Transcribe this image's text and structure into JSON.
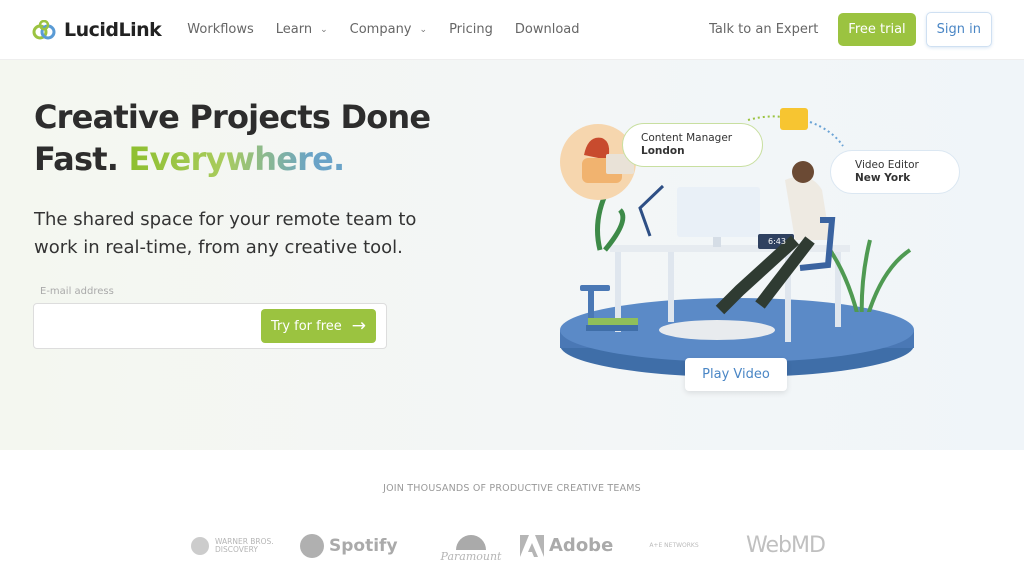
{
  "nav": {
    "brand": "LucidLink",
    "items": [
      {
        "label": "Workflows",
        "dropdown": false
      },
      {
        "label": "Learn",
        "dropdown": true
      },
      {
        "label": "Company",
        "dropdown": true
      },
      {
        "label": "Pricing",
        "dropdown": false
      },
      {
        "label": "Download",
        "dropdown": false
      }
    ],
    "talk": "Talk to an Expert",
    "free_trial": "Free trial",
    "sign_in": "Sign in"
  },
  "hero": {
    "title_line1": "Creative Projects Done",
    "title_fast": "Fast.",
    "title_accent": "Everywhere.",
    "subtitle": "The shared space for your remote team to work in real-time, from any creative tool.",
    "email_label": "E-mail address",
    "email_value": "",
    "cta": "Try for free"
  },
  "illustration": {
    "bubble1_role": "Content Manager",
    "bubble1_city": "London",
    "bubble2_role": "Video Editor",
    "bubble2_city": "New York",
    "clock": "6:43",
    "play": "Play Video"
  },
  "clients": {
    "heading": "JOIN THOUSANDS OF PRODUCTIVE CREATIVE TEAMS",
    "logos": [
      "WARNER BROS. DISCOVERY",
      "Spotify",
      "Paramount",
      "Adobe",
      "A+E NETWORKS",
      "WebMD"
    ]
  },
  "colors": {
    "accent_green": "#9bc340",
    "link_blue": "#4a86c5",
    "platform_blue": "#4a78b5"
  }
}
